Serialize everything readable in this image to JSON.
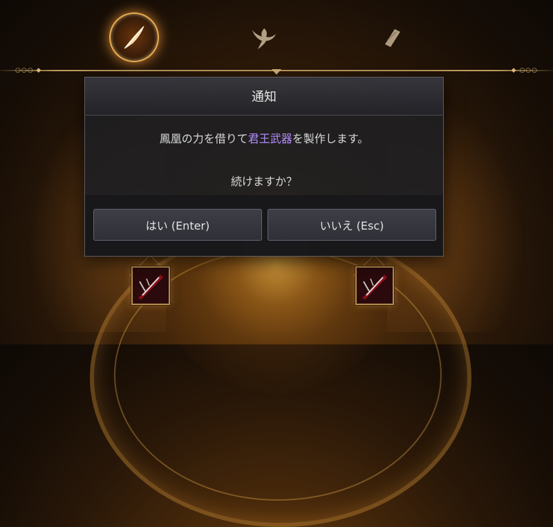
{
  "tabs": [
    {
      "name": "phoenix-feather-tab",
      "icon": "feather-icon",
      "active": true
    },
    {
      "name": "phoenix-bird-tab",
      "icon": "phoenix-icon",
      "active": false
    },
    {
      "name": "scroll-tab",
      "icon": "scroll-icon",
      "active": false
    }
  ],
  "dialog": {
    "title": "通知",
    "message_prefix": "鳳凰の力を借りて",
    "message_highlight": "君王武器",
    "message_suffix": "を製作します。",
    "question": "続けますか？",
    "confirm_label": "はい (Enter)",
    "cancel_label": "いいえ (Esc)"
  },
  "slots": [
    {
      "icon": "weapon-item-icon"
    },
    {
      "icon": "weapon-item-icon"
    }
  ],
  "colors": {
    "accent_gold": "#d6b47a",
    "highlight_purple": "#b48cff",
    "dialog_bg": "#1e1e22"
  }
}
